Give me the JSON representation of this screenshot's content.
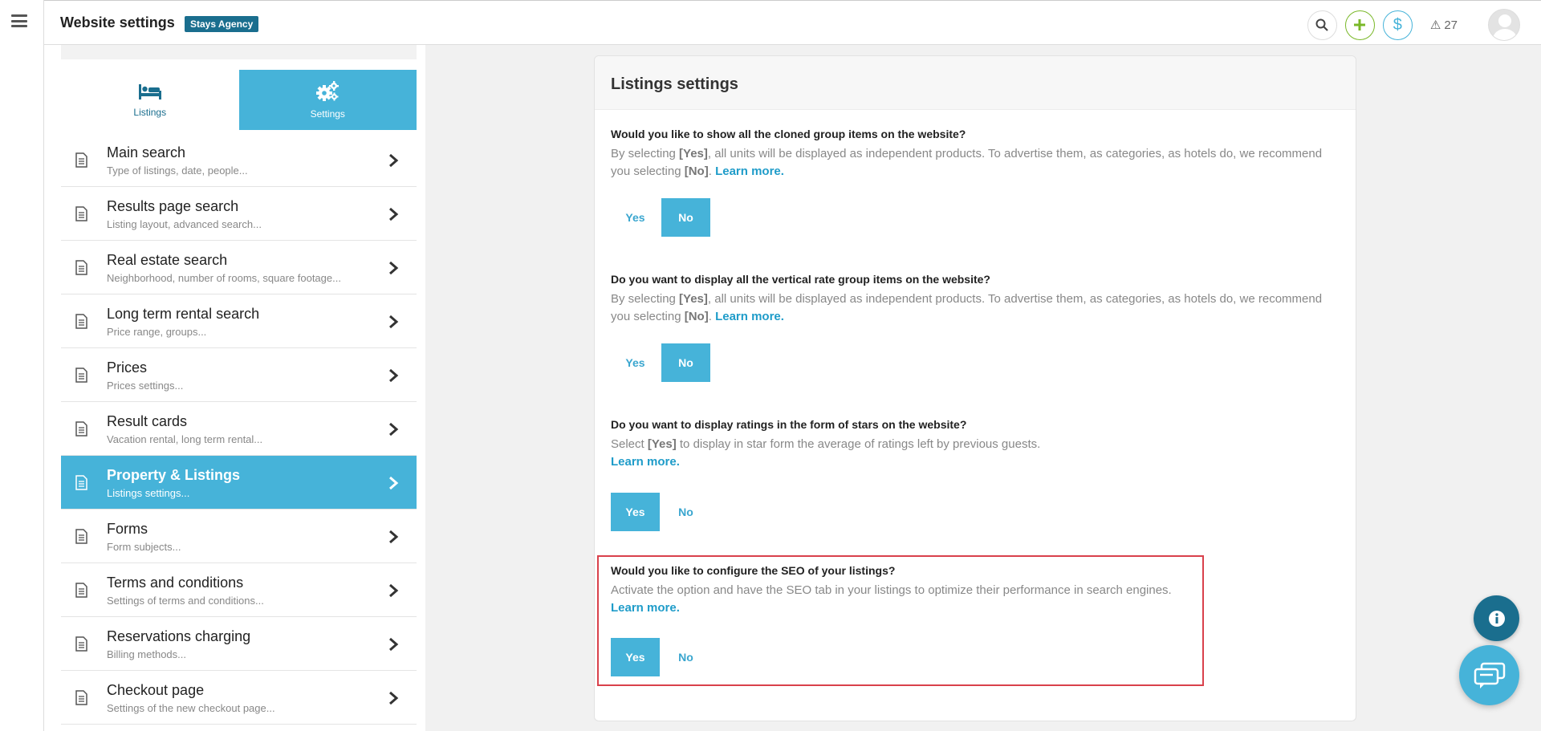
{
  "header": {
    "title": "Website settings",
    "badge": "Stays Agency",
    "alerts_count": "27"
  },
  "sidebar_tabs": [
    {
      "label": "Listings",
      "icon": "bed-icon",
      "active": false
    },
    {
      "label": "Settings",
      "icon": "gears-icon",
      "active": true
    }
  ],
  "menu": [
    {
      "title": "Main search",
      "subtitle": "Type of listings, date, people..."
    },
    {
      "title": "Results page search",
      "subtitle": "Listing layout, advanced search..."
    },
    {
      "title": "Real estate search",
      "subtitle": "Neighborhood, number of rooms, square footage..."
    },
    {
      "title": "Long term rental search",
      "subtitle": "Price range, groups..."
    },
    {
      "title": "Prices",
      "subtitle": "Prices settings..."
    },
    {
      "title": "Result cards",
      "subtitle": "Vacation rental, long term rental..."
    },
    {
      "title": "Property & Listings",
      "subtitle": "Listings settings..."
    },
    {
      "title": "Forms",
      "subtitle": "Form subjects..."
    },
    {
      "title": "Terms and conditions",
      "subtitle": "Settings of terms and conditions..."
    },
    {
      "title": "Reservations charging",
      "subtitle": "Billing methods..."
    },
    {
      "title": "Checkout page",
      "subtitle": "Settings of the new checkout page..."
    }
  ],
  "active_menu_index": 6,
  "card": {
    "title": "Listings settings",
    "questions": [
      {
        "title": "Would you like to show all the cloned group items on the website?",
        "desc_pre": "By selecting ",
        "desc_bold1": "[Yes]",
        "desc_mid": ", all units will be displayed as independent products. To advertise them, as categories, as hotels do, we recommend you selecting ",
        "desc_bold2": "[No]",
        "desc_post": ". ",
        "learn": "Learn more.",
        "selected": "No"
      },
      {
        "title": "Do you want to display all the vertical rate group items on the website?",
        "desc_pre": "By selecting ",
        "desc_bold1": "[Yes]",
        "desc_mid": ", all units will be displayed as independent products. To advertise them, as categories, as hotels do, we recommend you selecting ",
        "desc_bold2": "[No]",
        "desc_post": ". ",
        "learn": "Learn more.",
        "selected": "No"
      },
      {
        "title": "Do you want to display ratings in the form of stars on the website?",
        "desc_pre": "Select ",
        "desc_bold1": "[Yes]",
        "desc_mid": " to display in star form the average of ratings left by previous guests.",
        "learn": "Learn more.",
        "selected": "Yes"
      },
      {
        "title": "Would you like to configure the SEO of your listings?",
        "desc_pre": "Activate the option and have the SEO tab in your listings to optimize their performance in search engines.",
        "learn": "Learn more.",
        "selected": "Yes"
      }
    ],
    "yes_label": "Yes",
    "no_label": "No"
  },
  "colors": {
    "accent": "#46b3d9",
    "brand_dark": "#1a6e8e",
    "highlight": "#d9414b",
    "add_green": "#7ab829"
  }
}
